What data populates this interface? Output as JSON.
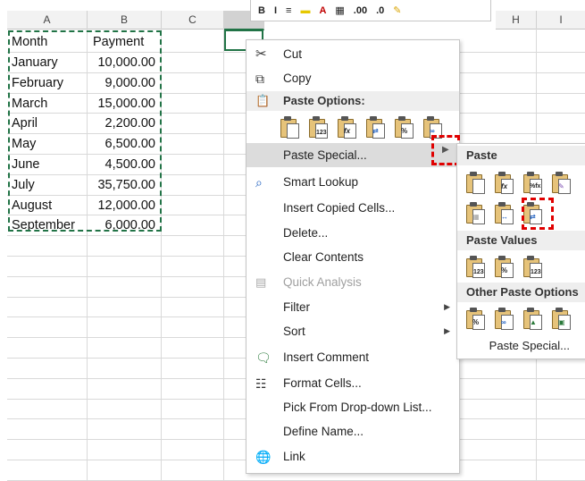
{
  "columns": [
    "A",
    "B",
    "C",
    "",
    "",
    "",
    "",
    "H",
    "I"
  ],
  "sheet": {
    "header": [
      "Month",
      "Payment"
    ],
    "rows": [
      {
        "month": "January",
        "payment": "10,000.00"
      },
      {
        "month": "February",
        "payment": "9,000.00"
      },
      {
        "month": "March",
        "payment": "15,000.00"
      },
      {
        "month": "April",
        "payment": "2,200.00"
      },
      {
        "month": "May",
        "payment": "6,500.00"
      },
      {
        "month": "June",
        "payment": "4,500.00"
      },
      {
        "month": "July",
        "payment": "35,750.00"
      },
      {
        "month": "August",
        "payment": "12,000.00"
      },
      {
        "month": "September",
        "payment": "6,000.00"
      }
    ]
  },
  "mini_toolbar": [
    "B",
    "I",
    ".00",
    ".0"
  ],
  "context_menu": {
    "cut": "Cut",
    "copy": "Copy",
    "paste_options_header": "Paste Options:",
    "paste_options_icons": [
      "paste-icon",
      "paste-values-icon",
      "paste-formulas-icon",
      "paste-transpose-icon",
      "paste-formatting-icon",
      "paste-link-icon"
    ],
    "paste_special": "Paste Special...",
    "smart_lookup": "Smart Lookup",
    "insert_copied_cells": "Insert Copied Cells...",
    "delete": "Delete...",
    "clear_contents": "Clear Contents",
    "quick_analysis": "Quick Analysis",
    "filter": "Filter",
    "sort": "Sort",
    "insert_comment": "Insert Comment",
    "format_cells": "Format Cells...",
    "pick_from_list": "Pick From Drop-down List...",
    "define_name": "Define Name...",
    "link": "Link"
  },
  "submenu": {
    "paste_header": "Paste",
    "paste_values_header": "Paste Values",
    "other_header": "Other Paste Options",
    "paste_special_link": "Paste Special...",
    "paste_tags": [
      "",
      "fx",
      "%fx",
      "",
      "",
      "",
      ""
    ],
    "values_tags": [
      "123",
      "%",
      "123"
    ],
    "other_tags": [
      "%",
      "",
      "",
      ""
    ]
  },
  "colors": {
    "accent": "#217346",
    "highlight_dash": "#e00000"
  }
}
